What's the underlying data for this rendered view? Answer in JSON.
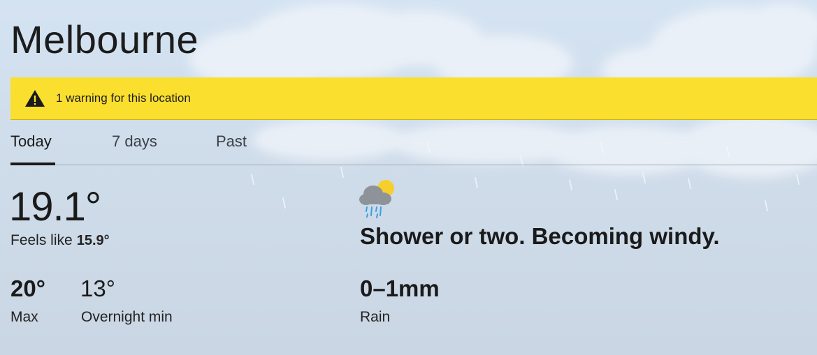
{
  "location": {
    "name": "Melbourne"
  },
  "warning": {
    "text": "1 warning for this location",
    "color": "#fadf2e",
    "icon": "warning-triangle-icon"
  },
  "tabs": [
    {
      "label": "Today",
      "active": true
    },
    {
      "label": "7 days",
      "active": false
    },
    {
      "label": "Past",
      "active": false
    }
  ],
  "current": {
    "temperature": "19.1°",
    "feels_like_label": "Feels like",
    "feels_like_value": "15.9°"
  },
  "today": {
    "max_value": "20°",
    "max_label": "Max",
    "min_value": "13°",
    "min_label": "Overnight min",
    "forecast_icon": "cloud-sun-rain-icon",
    "forecast_text": "Shower or two. Becoming windy.",
    "rain_value": "0–1mm",
    "rain_label": "Rain"
  }
}
